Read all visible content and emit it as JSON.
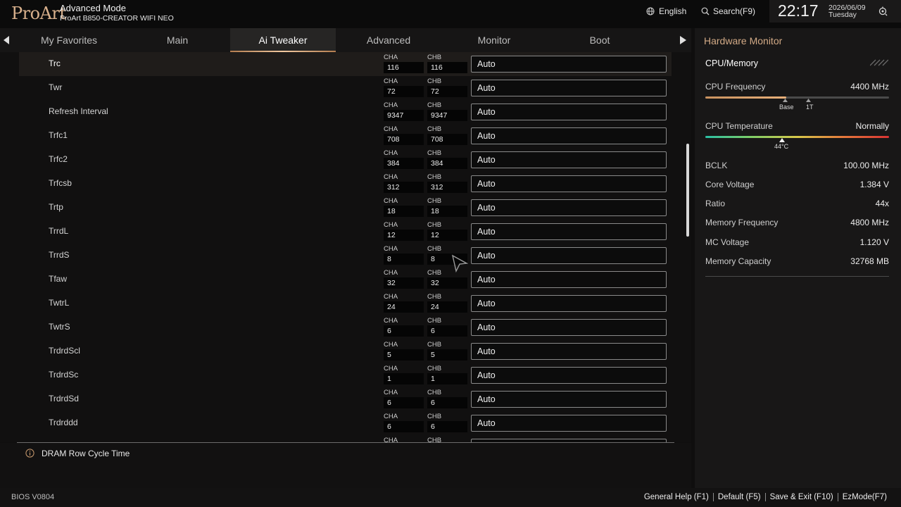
{
  "header": {
    "logo": "ProArt",
    "mode": "Advanced Mode",
    "board": "ProArt B850-CREATOR WIFI NEO",
    "language": "English",
    "search": "Search(F9)",
    "time": "22:17",
    "date": "2026/06/09",
    "weekday": "Tuesday"
  },
  "tabs": [
    "My Favorites",
    "Main",
    "Ai Tweaker",
    "Advanced",
    "Monitor",
    "Boot"
  ],
  "active_tab": "Ai Tweaker",
  "channel_labels": {
    "a": "CHA",
    "b": "CHB"
  },
  "rows": [
    {
      "label": "Trc",
      "cha": "116",
      "chb": "116",
      "value": "Auto"
    },
    {
      "label": "Twr",
      "cha": "72",
      "chb": "72",
      "value": "Auto"
    },
    {
      "label": "Refresh Interval",
      "cha": "9347",
      "chb": "9347",
      "value": "Auto"
    },
    {
      "label": "Trfc1",
      "cha": "708",
      "chb": "708",
      "value": "Auto"
    },
    {
      "label": "Trfc2",
      "cha": "384",
      "chb": "384",
      "value": "Auto"
    },
    {
      "label": "Trfcsb",
      "cha": "312",
      "chb": "312",
      "value": "Auto"
    },
    {
      "label": "Trtp",
      "cha": "18",
      "chb": "18",
      "value": "Auto"
    },
    {
      "label": "TrrdL",
      "cha": "12",
      "chb": "12",
      "value": "Auto"
    },
    {
      "label": "TrrdS",
      "cha": "8",
      "chb": "8",
      "value": "Auto"
    },
    {
      "label": "Tfaw",
      "cha": "32",
      "chb": "32",
      "value": "Auto"
    },
    {
      "label": "TwtrL",
      "cha": "24",
      "chb": "24",
      "value": "Auto"
    },
    {
      "label": "TwtrS",
      "cha": "6",
      "chb": "6",
      "value": "Auto"
    },
    {
      "label": "TrdrdScl",
      "cha": "5",
      "chb": "5",
      "value": "Auto"
    },
    {
      "label": "TrdrdSc",
      "cha": "1",
      "chb": "1",
      "value": "Auto"
    },
    {
      "label": "TrdrdSd",
      "cha": "6",
      "chb": "6",
      "value": "Auto"
    },
    {
      "label": "Trdrddd",
      "cha": "6",
      "chb": "6",
      "value": "Auto"
    },
    {
      "label": "",
      "cha": "",
      "chb": "",
      "value": ""
    }
  ],
  "help_text": "DRAM Row Cycle Time",
  "hw_monitor": {
    "title": "Hardware Monitor",
    "section": "CPU/Memory",
    "cpu_frequency": {
      "label": "CPU Frequency",
      "value": "4400 MHz",
      "fill_fraction": 0.44,
      "base_label": "Base",
      "turbo_label": "1T"
    },
    "cpu_temperature": {
      "label": "CPU Temperature",
      "value": "Normally",
      "marker_label": "44°C"
    },
    "stats": [
      {
        "label": "BCLK",
        "value": "100.00 MHz"
      },
      {
        "label": "Core Voltage",
        "value": "1.384 V"
      },
      {
        "label": "Ratio",
        "value": "44x"
      },
      {
        "label": "Memory Frequency",
        "value": "4800 MHz"
      },
      {
        "label": "MC Voltage",
        "value": "1.120 V"
      },
      {
        "label": "Memory Capacity",
        "value": "32768 MB"
      }
    ]
  },
  "footer": {
    "bios": "BIOS V0804",
    "keys": [
      "General Help (F1)",
      "Default (F5)",
      "Save & Exit (F10)",
      "EzMode(F7)"
    ]
  },
  "colors": {
    "accent": "#d2aa86",
    "background": "#0f0e0e",
    "panel": "#181717"
  }
}
